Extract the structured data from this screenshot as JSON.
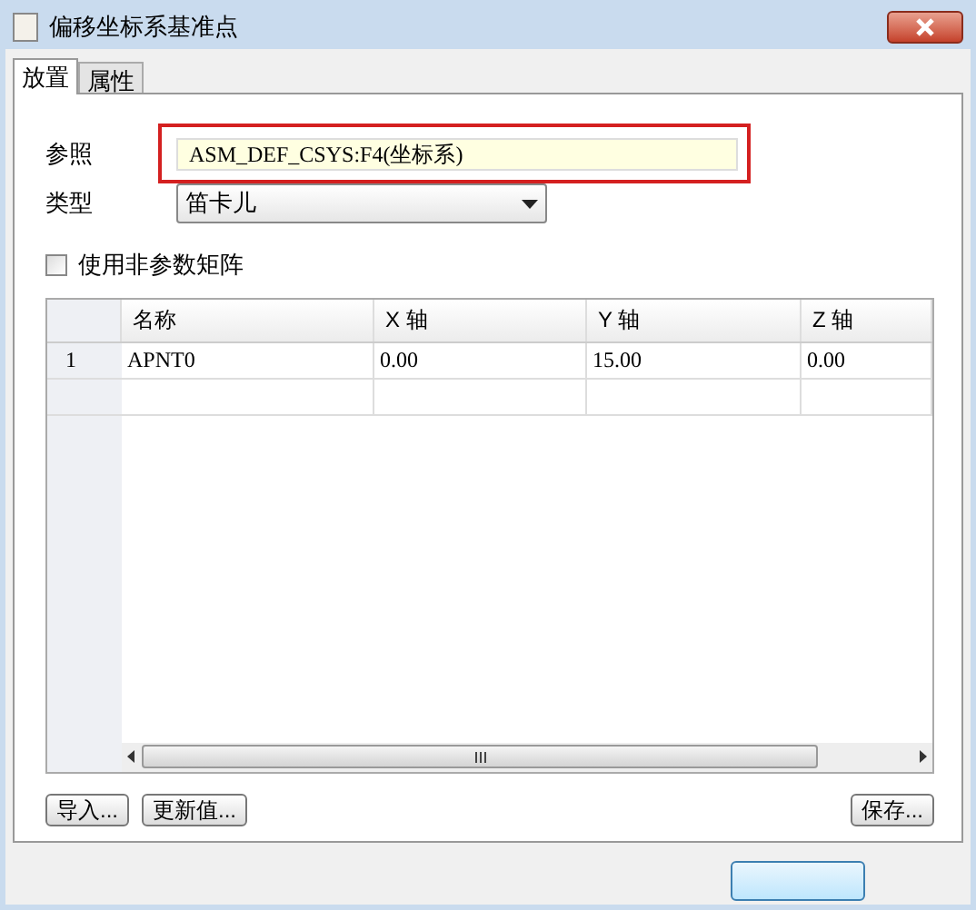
{
  "window": {
    "title": "偏移坐标系基准点"
  },
  "tabs": [
    {
      "label": "放置",
      "selected": true
    },
    {
      "label": "属性",
      "selected": false
    }
  ],
  "reference": {
    "label": "参照",
    "value": "ASM_DEF_CSYS:F4(坐标系)",
    "highlighted": true
  },
  "type": {
    "label": "类型",
    "value": "笛卡儿"
  },
  "nonparametric": {
    "label": "使用非参数矩阵",
    "checked": false
  },
  "table": {
    "columns": [
      "名称",
      "X 轴",
      "Y 轴",
      "Z 轴"
    ],
    "rows": [
      {
        "index": "1",
        "cells": [
          "APNT0",
          "0.00",
          "15.00",
          "0.00"
        ]
      }
    ]
  },
  "buttons": [
    "导入...",
    "更新值...",
    "保存..."
  ]
}
